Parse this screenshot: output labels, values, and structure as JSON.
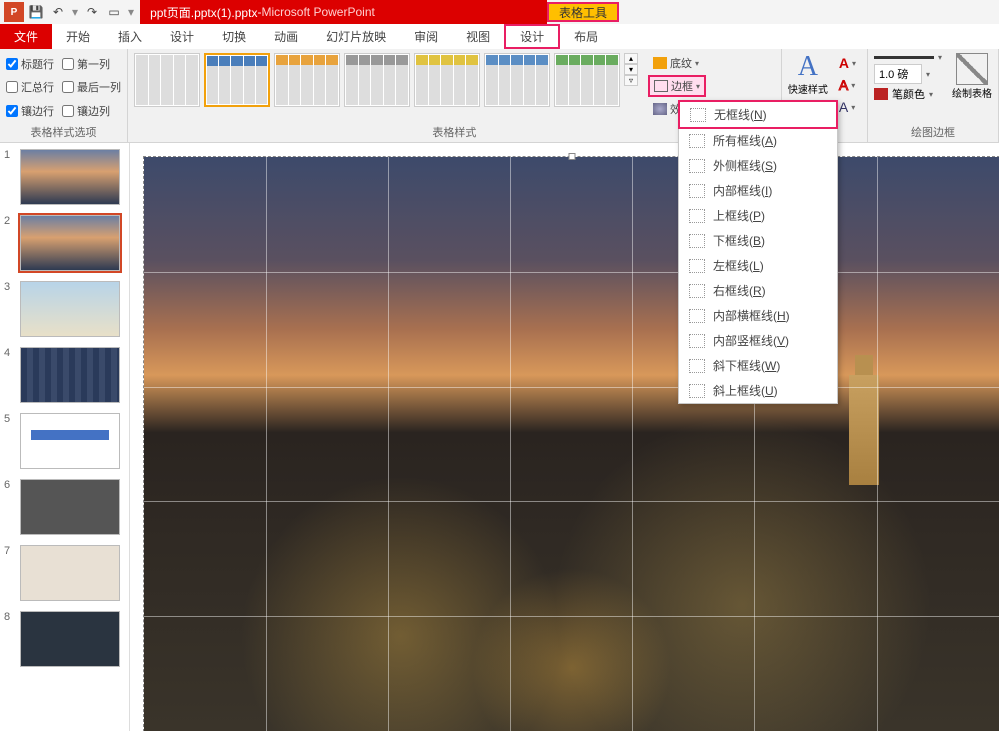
{
  "titlebar": {
    "filename": "ppt页面.pptx(1).pptx",
    "separator": " - ",
    "app": "Microsoft PowerPoint",
    "tools_context": "表格工具"
  },
  "tabs": {
    "file": "文件",
    "home": "开始",
    "insert": "插入",
    "design_main": "设计",
    "transitions": "切换",
    "animations": "动画",
    "slideshow": "幻灯片放映",
    "review": "审阅",
    "view": "视图",
    "design": "设计",
    "layout": "布局"
  },
  "group_labels": {
    "style_options": "表格样式选项",
    "table_styles": "表格样式",
    "draw_borders": "绘图边框"
  },
  "checks": {
    "header_row": "标题行",
    "first_col": "第一列",
    "total_row": "汇总行",
    "last_col": "最后一列",
    "banded_row": "镶边行",
    "banded_col": "镶边列"
  },
  "shading": {
    "shading": "底纹",
    "border": "边框",
    "effects": "效果"
  },
  "wordart": {
    "quick_styles": "快速样式"
  },
  "pen": {
    "weight_value": "1.0 磅",
    "color": "笔颜色"
  },
  "draw_table": "绘制表格",
  "borders_menu": {
    "items": [
      {
        "label": "无框线",
        "accel": "N"
      },
      {
        "label": "所有框线",
        "accel": "A"
      },
      {
        "label": "外侧框线",
        "accel": "S"
      },
      {
        "label": "内部框线",
        "accel": "I"
      },
      {
        "label": "上框线",
        "accel": "P"
      },
      {
        "label": "下框线",
        "accel": "B"
      },
      {
        "label": "左框线",
        "accel": "L"
      },
      {
        "label": "右框线",
        "accel": "R"
      },
      {
        "label": "内部横框线",
        "accel": "H"
      },
      {
        "label": "内部竖框线",
        "accel": "V"
      },
      {
        "label": "斜下框线",
        "accel": "W"
      },
      {
        "label": "斜上框线",
        "accel": "U"
      }
    ]
  },
  "thumbs": [
    "1",
    "2",
    "3",
    "4",
    "5",
    "6",
    "7",
    "8"
  ]
}
